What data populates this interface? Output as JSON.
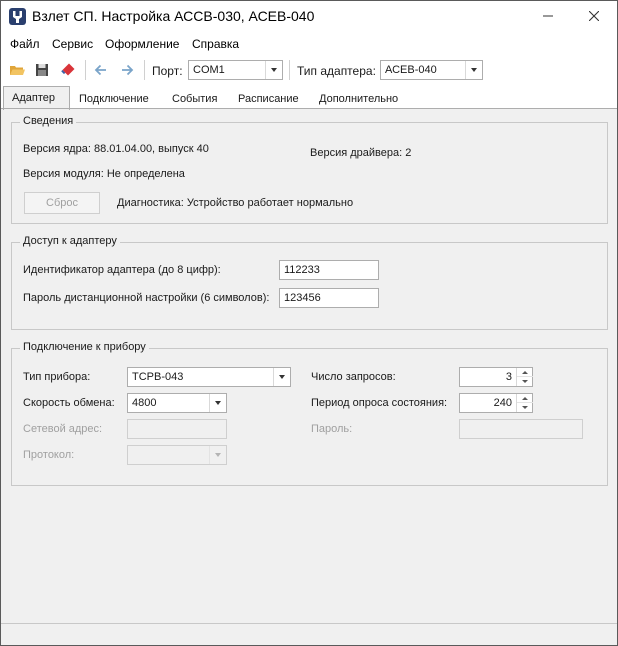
{
  "window": {
    "title": "Взлет СП. Настройка АССВ-030, АСЕВ-040",
    "minimize_icon": "minimize-icon",
    "maximize_icon": "maximize-icon",
    "close_icon": "close-icon"
  },
  "menu": {
    "items": [
      "Файл",
      "Сервис",
      "Оформление",
      "Справка"
    ]
  },
  "toolbar": {
    "icons": [
      "open-folder-icon",
      "save-icon",
      "eraser-icon",
      "back-arrow-icon",
      "forward-arrow-icon"
    ],
    "port_label": "Порт:",
    "port_value": "COM1",
    "adapter_type_label": "Тип адаптера:",
    "adapter_type_value": "АСЕВ-040"
  },
  "tabs": [
    {
      "label": "Адаптер",
      "active": true
    },
    {
      "label": "Подключение",
      "active": false
    },
    {
      "label": "События",
      "active": false
    },
    {
      "label": "Расписание",
      "active": false
    },
    {
      "label": "Дополнительно",
      "active": false
    }
  ],
  "info": {
    "title": "Сведения",
    "core_version": "Версия ядра: 88.01.04.00, выпуск 40",
    "driver_version": "Версия драйвера: 2",
    "module_version": "Версия модуля: Не определена",
    "reset_button": "Сброс",
    "diagnostics": "Диагностика: Устройство работает нормально"
  },
  "access": {
    "title": "Доступ к адаптеру",
    "id_label": "Идентификатор адаптера (до 8 цифр):",
    "id_value": "112233",
    "password_label": "Пароль дистанционной настройки (6 символов):",
    "password_value": "123456"
  },
  "device": {
    "title": "Подключение к прибору",
    "device_type_label": "Тип прибора:",
    "device_type_value": "ТСРВ-043",
    "speed_label": "Скорость обмена:",
    "speed_value": "4800",
    "net_address_label": "Сетевой адрес:",
    "net_address_value": "",
    "protocol_label": "Протокол:",
    "protocol_value": "",
    "requests_label": "Число запросов:",
    "requests_value": "3",
    "poll_period_label": "Период опроса состояния:",
    "poll_period_value": "240",
    "password_label": "Пароль:",
    "password_value": ""
  },
  "colors": {
    "accent": "#2a3f6e",
    "folder": "#e0a53a",
    "eraser": "#d9343a",
    "nav_arrow": "#7aa4c9",
    "dim_text": "#a0a0a0"
  }
}
